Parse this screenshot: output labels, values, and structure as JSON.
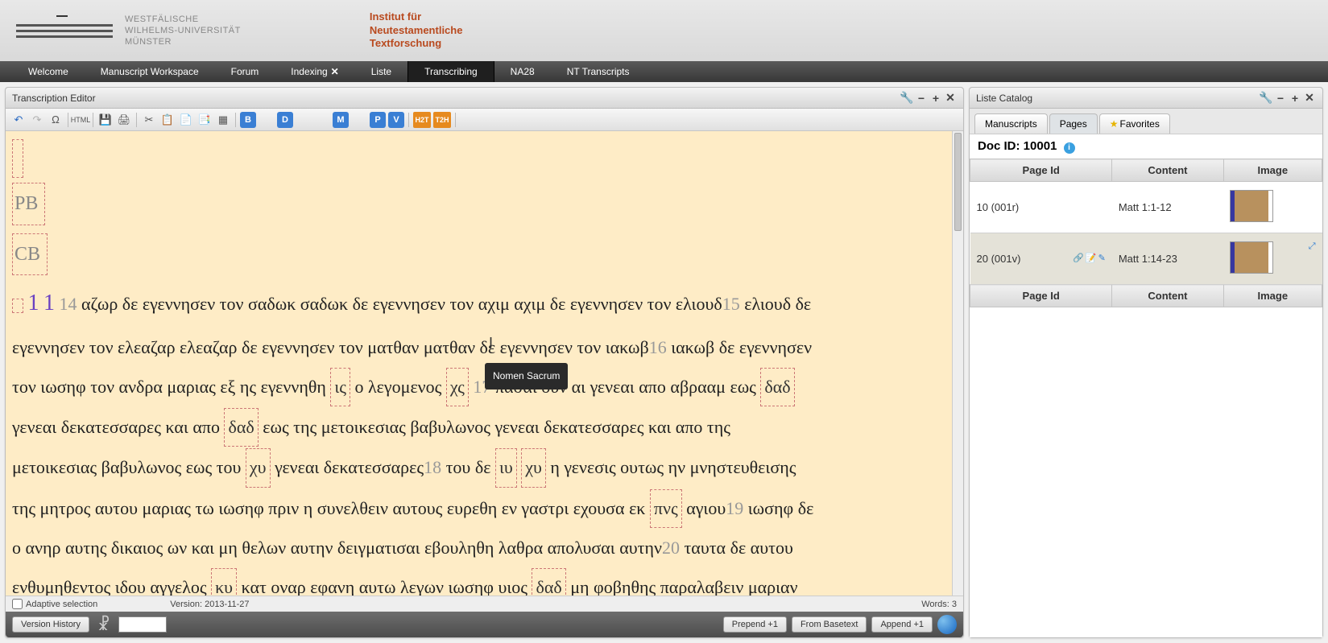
{
  "header": {
    "uni_line1": "WESTFÄLISCHE",
    "uni_line2": "WILHELMS-UNIVERSITÄT",
    "uni_line3": "MÜNSTER",
    "inst_line1": "Institut für",
    "inst_line2": "Neutestamentliche",
    "inst_line3": "Textforschung"
  },
  "nav": {
    "welcome": "Welcome",
    "workspace": "Manuscript Workspace",
    "forum": "Forum",
    "indexing": "Indexing",
    "liste": "Liste",
    "transcribing": "Transcribing",
    "na28": "NA28",
    "nt_transcripts": "NT Transcripts"
  },
  "left_panel": {
    "title": "Transcription Editor",
    "toolbar": {
      "undo": "↶",
      "redo": "↷",
      "omega": "Ω",
      "html": "HTML",
      "b": "B",
      "d": "D",
      "m": "M",
      "p": "P",
      "v": "V",
      "h2t": "H2T",
      "t2h": "T2H"
    },
    "editor": {
      "pb": "PB",
      "cb": "CB",
      "chap": "1",
      "chap2": "1",
      "v14": "14",
      "v15": "15",
      "v16": "16",
      "v17": "17",
      "v18": "18",
      "v19": "19",
      "v20": "20",
      "t14a": " αζωρ δε εγεννησεν τον σαδωκ σαδωκ δε εγεννησεν τον αχιμ αχιμ δε εγεννησεν τον ελιουδ",
      "t15a": " ελιουδ δε",
      "t15b": "εγεννησεν τον ελεαζαρ ελεαζαρ δε εγεννησεν τον ματθαν ματθαν δε εγεννησεν τον ιακωβ",
      "t16a": " ιακωβ δε εγεννησεν",
      "t16b": "τον ιωσηφ τον ανδρα μαριας εξ ης εγεννηθη ",
      "ns_is": "ις",
      "t16c": " ο λεγομενος ",
      "ns_chs": "χς",
      "t17a": " πασαι ουν αι γενεαι απο αβρααμ εως ",
      "ns_dad1": "δαδ",
      "t17b": "γενεαι δεκατεσσαρες και απο ",
      "ns_dad2": "δαδ",
      "t17c": " εως της μετοικεσιας βαβυλωνος γενεαι δεκατεσσαρες και απο της",
      "t17d": "μετοικεσιας βαβυλωνος εως του ",
      "ns_chu": "χυ",
      "t17e": " γενεαι δεκατεσσαρες",
      "t18a": " του δε ",
      "ns_iu": "ιυ",
      "ns_chu2": "χυ",
      "t18b": " η γενεσις ουτως ην μνηστευθεισης",
      "t18c": "της μητρος αυτου μαριας τω ιωσηφ πριν η συνελθειν αυτους ευρεθη εν γαστρι εχουσα εκ ",
      "ns_pns": "πνς",
      "t18d": " αγιου",
      "t19a": " ιωσηφ δε",
      "t19b": "ο ανηρ αυτης δικαιος ων και μη θελων αυτην δειγματισαι εβουληθη λαθρα απολυσαι αυτην",
      "t20a": " ταυτα δε αυτου",
      "t20b": "ενθυμηθεντος ιδου αγγελος ",
      "ns_ku": "κυ",
      "t20c": " κατ οναρ εφανη αυτω λεγων ιωσηφ υιος ",
      "ns_dad3": "δαδ",
      "t20d": " μη φοβηθης παραλαβειν μαριαν",
      "tooltip": "Nomen Sacrum"
    },
    "status": {
      "adaptive": "Adaptive selection",
      "version": "Version: 2013-11-27",
      "words": "Words: 3"
    },
    "actions": {
      "version_history": "Version History",
      "prepend": "Prepend +1",
      "basetext": "From Basetext",
      "append": "Append +1"
    }
  },
  "right_panel": {
    "title": "Liste Catalog",
    "tabs": {
      "manuscripts": "Manuscripts",
      "pages": "Pages",
      "favorites": "Favorites"
    },
    "doc_id_label": "Doc ID: ",
    "doc_id_value": "10001",
    "cols": {
      "page_id": "Page Id",
      "content": "Content",
      "image": "Image"
    },
    "rows": [
      {
        "page_id": "10 (001r)",
        "content": "Matt 1:1-12"
      },
      {
        "page_id": "20 (001v)",
        "content": "Matt 1:14-23"
      }
    ]
  }
}
